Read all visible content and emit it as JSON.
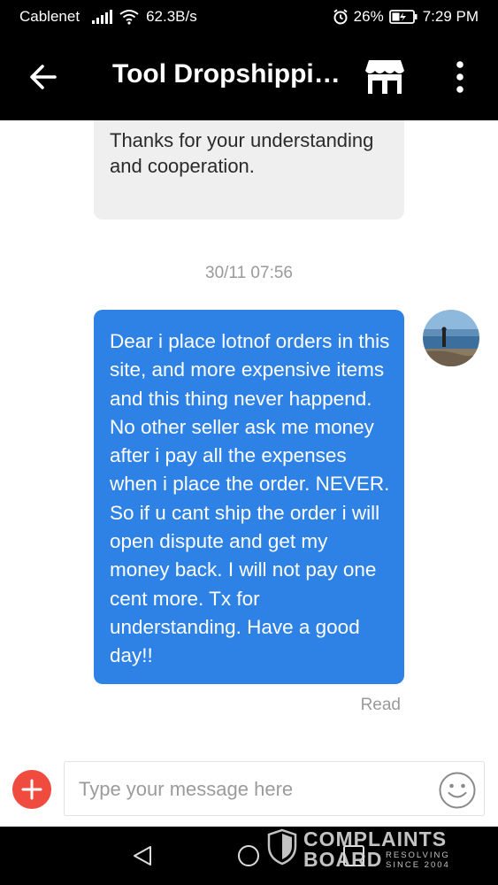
{
  "status_bar": {
    "carrier": "Cablenet",
    "net_speed": "62.3B/s",
    "battery_percent": "26%",
    "time": "7:29 PM",
    "icons": [
      "signal-icon",
      "wifi-icon",
      "alarm-icon",
      "battery-icon"
    ]
  },
  "app_bar": {
    "title": "Tool Dropshippi…",
    "icons": [
      "back-arrow-icon",
      "store-icon",
      "more-vertical-icon"
    ]
  },
  "messages": [
    {
      "direction": "incoming",
      "text": "Thanks for your understanding and cooperation."
    },
    {
      "direction": "outgoing",
      "timestamp": "30/11 07:56",
      "text": "Dear i place lotnof orders in this site, and more expensive items and this thing never happend. No other seller ask me money after i pay all the expenses when i place the order. NEVER. So if u cant ship the order i will open dispute and get my money back. I will not pay one cent more. Tx for understanding. Have a good day!!",
      "status": "Read"
    }
  ],
  "input": {
    "placeholder": "Type your message here",
    "icons": [
      "plus-icon",
      "emoji-icon"
    ]
  },
  "nav_bar": {
    "icons": [
      "nav-back-icon",
      "nav-home-icon",
      "nav-recent-icon"
    ]
  },
  "watermark": {
    "line1": "COMPLAINTS",
    "line2": "BOARD",
    "tagline1": "RESOLVING",
    "tagline2": "SINCE 2004"
  },
  "colors": {
    "outgoing_bubble": "#2e82e6",
    "incoming_bubble": "#efefef",
    "plus_button": "#ef4b3f",
    "bars": "#000000"
  }
}
